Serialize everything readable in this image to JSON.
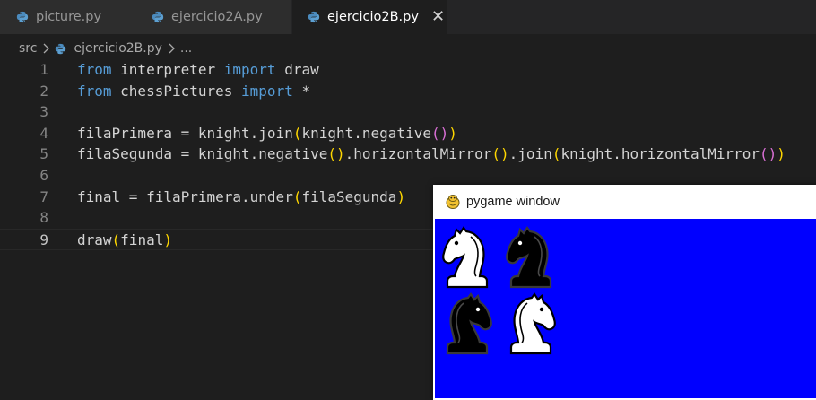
{
  "tabs": [
    {
      "label": "picture.py",
      "active": false
    },
    {
      "label": "ejercicio2A.py",
      "active": false
    },
    {
      "label": "ejercicio2B.py",
      "active": true
    }
  ],
  "breadcrumb": {
    "folder": "src",
    "file": "ejercicio2B.py",
    "more": "..."
  },
  "editor": {
    "lines": [
      {
        "n": "1",
        "tokens": [
          [
            "kw",
            "from"
          ],
          [
            "id",
            " interpreter "
          ],
          [
            "kw",
            "import"
          ],
          [
            "id",
            " draw"
          ]
        ]
      },
      {
        "n": "2",
        "tokens": [
          [
            "kw",
            "from"
          ],
          [
            "id",
            " chessPictures "
          ],
          [
            "kw",
            "import"
          ],
          [
            "id",
            " *"
          ]
        ]
      },
      {
        "n": "3",
        "tokens": []
      },
      {
        "n": "4",
        "tokens": [
          [
            "id",
            "filaPrimera = knight.join"
          ],
          [
            "p1",
            "("
          ],
          [
            "id",
            "knight.negative"
          ],
          [
            "p2",
            "()"
          ],
          [
            "p1",
            ")"
          ]
        ]
      },
      {
        "n": "5",
        "tokens": [
          [
            "id",
            "filaSegunda = knight.negative"
          ],
          [
            "p1",
            "()"
          ],
          [
            "id",
            ".horizontalMirror"
          ],
          [
            "p1",
            "()"
          ],
          [
            "id",
            ".join"
          ],
          [
            "p1",
            "("
          ],
          [
            "id",
            "knight.horizontalMirror"
          ],
          [
            "p2",
            "()"
          ],
          [
            "p1",
            ")"
          ]
        ]
      },
      {
        "n": "6",
        "tokens": []
      },
      {
        "n": "7",
        "tokens": [
          [
            "id",
            "final = filaPrimera.under"
          ],
          [
            "p1",
            "("
          ],
          [
            "id",
            "filaSegunda"
          ],
          [
            "p1",
            ")"
          ]
        ]
      },
      {
        "n": "8",
        "tokens": []
      },
      {
        "n": "9",
        "tokens": [
          [
            "id",
            "draw"
          ],
          [
            "p1",
            "("
          ],
          [
            "id",
            "final"
          ],
          [
            "p1",
            ")"
          ]
        ]
      }
    ],
    "current_line": "9"
  },
  "pygame_window": {
    "title": "pygame window",
    "background_color": "#0000ff",
    "knights": [
      {
        "color": "white",
        "facing": "left"
      },
      {
        "color": "black",
        "facing": "left"
      },
      {
        "color": "black",
        "facing": "right"
      },
      {
        "color": "white",
        "facing": "right"
      }
    ]
  },
  "colors": {
    "editor_bg": "#1e1e1e",
    "keyword": "#569cd6",
    "identifier": "#d4d4d4",
    "bracket_level1": "#ffd700",
    "bracket_level2": "#da70d6"
  }
}
